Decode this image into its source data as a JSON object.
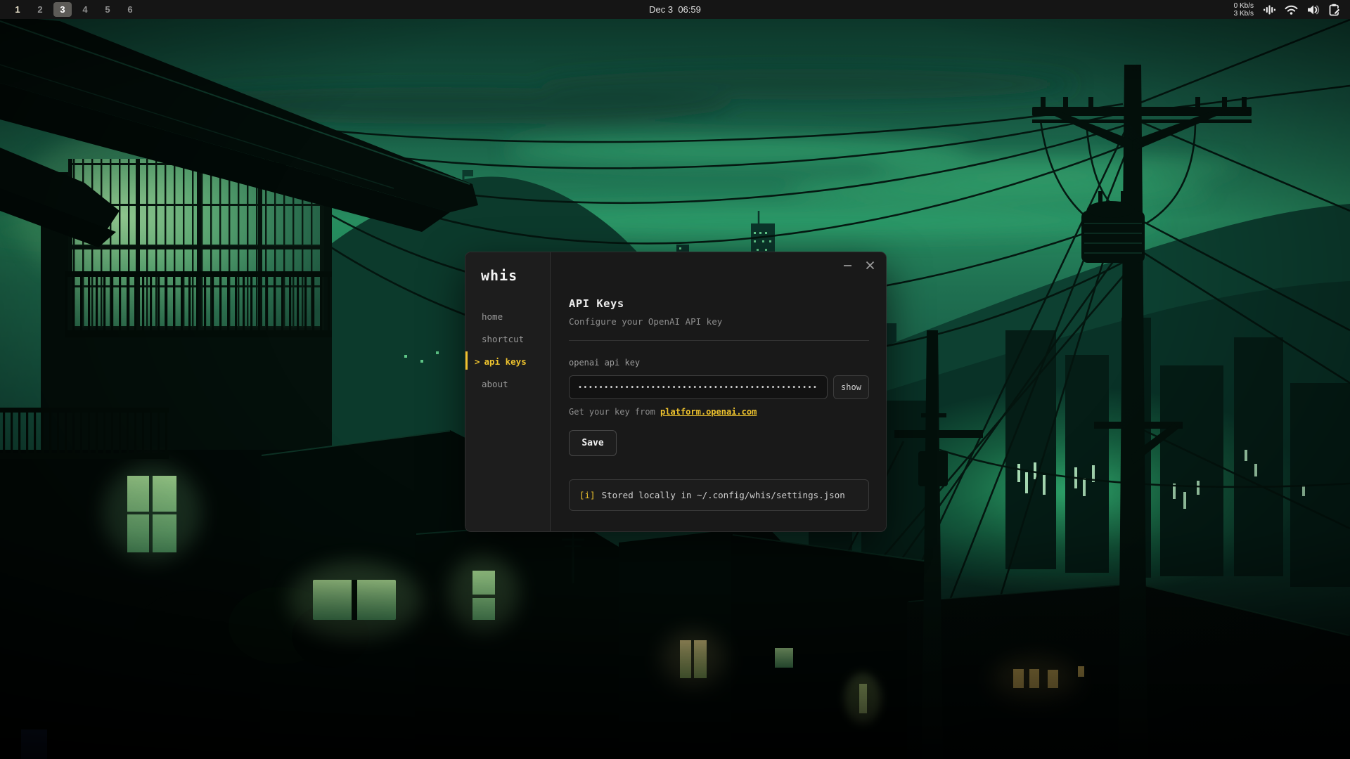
{
  "topbar": {
    "workspaces": [
      {
        "label": "1",
        "state": "occupied"
      },
      {
        "label": "2",
        "state": "normal"
      },
      {
        "label": "3",
        "state": "active"
      },
      {
        "label": "4",
        "state": "normal"
      },
      {
        "label": "5",
        "state": "normal"
      },
      {
        "label": "6",
        "state": "normal"
      }
    ],
    "clock": "Dec 3  06:59",
    "net_up": "0 Kb/s",
    "net_down": "3 Kb/s"
  },
  "window": {
    "title": "whis",
    "sidebar": {
      "items": [
        {
          "label": "home"
        },
        {
          "label": "shortcut"
        },
        {
          "label": "api keys",
          "prefix": ">",
          "active": true
        },
        {
          "label": "about"
        }
      ]
    },
    "main": {
      "heading": "API Keys",
      "subheading": "Configure your OpenAI API key",
      "field_label": "openai api key",
      "field_value_masked": "••••••••••••••••••••••••••••••••••••••••••••••••",
      "show_button": "show",
      "help_prefix": "Get your key from ",
      "help_link": "platform.openai.com",
      "save_button": "Save",
      "info_bracket": "[i]",
      "info_text": "Stored locally in ~/.config/whis/settings.json"
    }
  },
  "colors": {
    "accent_yellow": "#eec32e",
    "bar_background": "#151515",
    "window_background": "#191919",
    "wallpaper_green": "#1e7a54"
  }
}
